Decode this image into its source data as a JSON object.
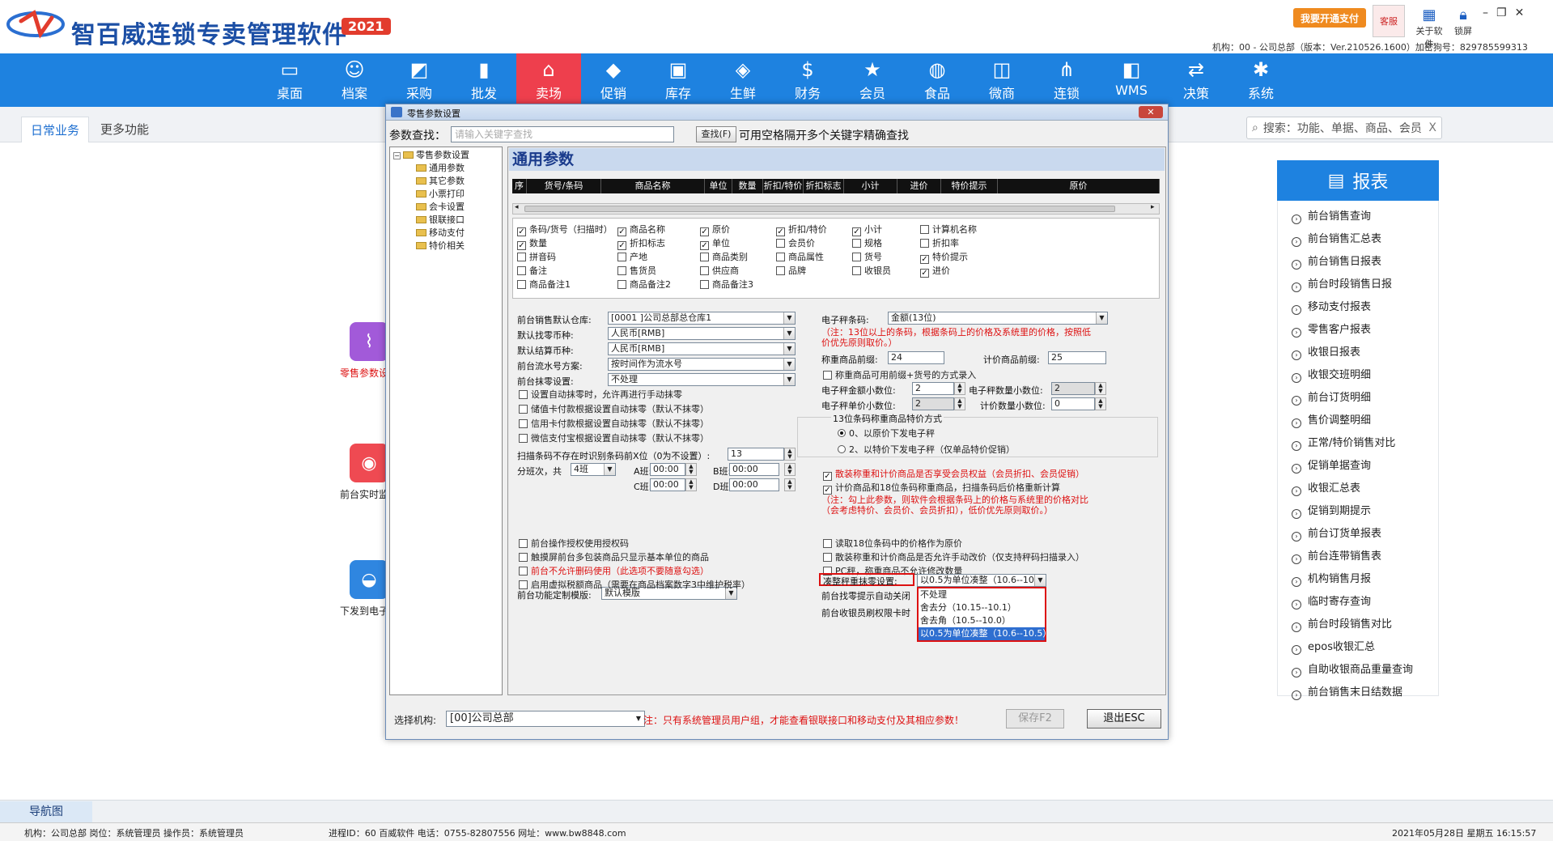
{
  "app": {
    "title": "智百威连锁专卖管理软件",
    "year": "2021",
    "pay_button": "我要开通支付",
    "service_label": "客服",
    "about_label": "关于软件",
    "lock_label": "锁屏",
    "org_info": "机构：00 - 公司总部（版本：Ver.210526.1600）加密狗号：829785599313"
  },
  "menu": [
    {
      "label": "桌面",
      "icon": "monitor-icon",
      "glyph": "▭"
    },
    {
      "label": "档案",
      "icon": "user-icon",
      "glyph": "☺"
    },
    {
      "label": "采购",
      "icon": "chart-icon",
      "glyph": "◩"
    },
    {
      "label": "批发",
      "icon": "bar-chart-icon",
      "glyph": "▮"
    },
    {
      "label": "卖场",
      "icon": "store-icon",
      "glyph": "⌂"
    },
    {
      "label": "促销",
      "icon": "tag-icon",
      "glyph": "◆"
    },
    {
      "label": "库存",
      "icon": "box-icon",
      "glyph": "▣"
    },
    {
      "label": "生鲜",
      "icon": "fish-icon",
      "glyph": "◈"
    },
    {
      "label": "财务",
      "icon": "money-icon",
      "glyph": "$"
    },
    {
      "label": "会员",
      "icon": "star-icon",
      "glyph": "★"
    },
    {
      "label": "食品",
      "icon": "basket-icon",
      "glyph": "◍"
    },
    {
      "label": "微商",
      "icon": "shop-icon",
      "glyph": "◫"
    },
    {
      "label": "连锁",
      "icon": "share-icon",
      "glyph": "⋔"
    },
    {
      "label": "WMS",
      "icon": "cubes-icon",
      "glyph": "◧"
    },
    {
      "label": "决策",
      "icon": "decision-icon",
      "glyph": "⇄"
    },
    {
      "label": "系统",
      "icon": "gear-icon",
      "glyph": "✱"
    }
  ],
  "tabs": {
    "daily": "日常业务",
    "more": "更多功能"
  },
  "search": {
    "placeholder": "搜索：功能、单据、商品、会员",
    "clear": "X"
  },
  "functions": [
    {
      "label": "零售参数设置"
    },
    {
      "label": "前台实时监控"
    },
    {
      "label": "下发到电子秤"
    }
  ],
  "report": {
    "title": "报表",
    "items": [
      "前台销售查询",
      "前台销售汇总表",
      "前台销售日报表",
      "前台时段销售日报",
      "移动支付报表",
      "零售客户报表",
      "收银日报表",
      "收银交班明细",
      "前台订货明细",
      "售价调整明细",
      "正常/特价销售对比",
      "促销单据查询",
      "收银汇总表",
      "促销到期提示",
      "前台订货单报表",
      "前台连带销售表",
      "机构销售月报",
      "临时寄存查询",
      "前台时段销售对比",
      "epos收银汇总",
      "自助收银商品重量查询",
      "前台销售末日结数据"
    ]
  },
  "navtab": "导航图",
  "status": {
    "left": "机构：公司总部  岗位：系统管理员  操作员：系统管理员",
    "mid": "进程ID：60  百威软件 电话：0755-82807556 网址：www.bw8848.com",
    "right": "2021年05月28日 星期五     16:15:57"
  },
  "dialog": {
    "title": "零售参数设置",
    "close": "✕",
    "search_label": "参数查找：",
    "search_placeholder": "请输入关键字查找",
    "search_button": "查找(F)",
    "search_hint": "可用空格隔开多个关键字精确查找",
    "tree": {
      "root": "零售参数设置",
      "children": [
        "通用参数",
        "其它参数",
        "小票打印",
        "会卡设置",
        "银联接口",
        "移动支付",
        "特价相关"
      ]
    },
    "panel_title": "通用参数",
    "grid_columns": [
      "序",
      "货号/条码",
      "商品名称",
      "单位",
      "数量",
      "折扣/特价",
      "折扣标志",
      "小计",
      "进价",
      "特价提示",
      "原价"
    ],
    "column_checks": [
      [
        "条码/货号（扫描时）",
        true
      ],
      [
        "商品名称",
        true
      ],
      [
        "原价",
        true
      ],
      [
        "折扣/特价",
        true
      ],
      [
        "小计",
        true
      ],
      [
        "计算机名称",
        false
      ],
      [
        "数量",
        true
      ],
      [
        "折扣标志",
        true
      ],
      [
        "单位",
        true
      ],
      [
        "会员价",
        false
      ],
      [
        "规格",
        false
      ],
      [
        "折扣率",
        false
      ],
      [
        "拼音码",
        false
      ],
      [
        "产地",
        false
      ],
      [
        "商品类别",
        false
      ],
      [
        "商品属性",
        false
      ],
      [
        "货号",
        false
      ],
      [
        "特价提示",
        true
      ],
      [
        "备注",
        false
      ],
      [
        "售货员",
        false
      ],
      [
        "供应商",
        false
      ],
      [
        "品牌",
        false
      ],
      [
        "收银员",
        false
      ],
      [
        "进价",
        true
      ],
      [
        "商品备注1",
        false
      ],
      [
        "商品备注2",
        false
      ],
      [
        "商品备注3",
        false
      ]
    ],
    "left": {
      "warehouse_label": "前台销售默认仓库:",
      "warehouse_value": "[0001  ]公司总部总仓库1",
      "change_currency_label": "默认找零币种:",
      "change_currency_value": "人民币[RMB]",
      "settle_currency_label": "默认结算币种:",
      "settle_currency_value": "人民币[RMB]",
      "flow_label": "前台流水号方案:",
      "flow_value": "按时间作为流水号",
      "round_label": "前台抹零设置:",
      "round_value": "不处理",
      "checks": [
        "设置自动抹零时，允许再进行手动抹零",
        "储值卡付款根据设置自动抹零（默认不抹零）",
        "信用卡付款根据设置自动抹零（默认不抹零）",
        "微信支付宝根据设置自动抹零（默认不抹零）"
      ],
      "scan_label": "扫描条码不存在时识别条码前X位（0为不设置）:",
      "scan_value": "13",
      "shift_label": "分班次，共",
      "shift_value": "4班",
      "shift_a": "A班:",
      "shift_b": "B班:",
      "shift_c": "C班:",
      "shift_d": "D班:",
      "time_a": "00:00",
      "time_b": "00:00",
      "time_c": "00:00",
      "time_d": "00:00",
      "checks2": [
        "前台操作授权使用授权码",
        "触摸屏前台多包装商品只显示基本单位的商品"
      ],
      "red_check": "前台不允许删码使用（此选项不要随意勾选）",
      "check_tax": "启用虚拟税额商品（需要在商品档案数字3中维护税率）",
      "template_label": "前台功能定制模版:",
      "template_value": "默认模版"
    },
    "right": {
      "scale_label": "电子秤条码:",
      "scale_value": "金额(13位)",
      "scale_note": "（注：13位以上的条码，根据条码上的价格及系统里的价格，按照低价优先原则取价。）",
      "weigh_prefix_label": "称重商品前缀:",
      "weigh_prefix_value": "24",
      "count_prefix_label": "计价商品前缀:",
      "count_prefix_value": "25",
      "weigh_check": "称重商品可用前缀+货号的方式录入",
      "amount_dec_label": "电子秤金额小数位:",
      "amount_dec_value": "2",
      "qty_dec_label": "电子秤数量小数位:",
      "qty_dec_value": "2",
      "price_dec_label": "电子秤单价小数位:",
      "price_dec_value": "2",
      "count_dec_label": "计价数量小数位:",
      "count_dec_value": "0",
      "group_title": "13位条码称重商品特价方式",
      "radio1": "0、以原价下发电子秤",
      "radio2": "2、以特价下发电子秤（仅单品特价促销）",
      "red_check1": "散装称重和计价商品是否享受会员权益（会员折扣、会员促销）",
      "check2": "计价商品和18位条码称重商品，扫描条码后价格重新计算",
      "note2": "（注：勾上此参数，则软件会根据条码上的价格与系统里的价格对比（会考虑特价、会员价、会员折扣），低价优先原则取价。）",
      "check3": "读取18位条码中的价格作为原价",
      "check4": "散装称重和计价商品是否允许手动改价（仅支持秤码扫描录入）",
      "check5": "PC秤，称重商品不允许修改数量",
      "round_label": "凑整秤重抹零设置:",
      "round_value": "以0.5为单位凑整（10.6--10.5）",
      "hint_label": "前台找零提示自动关闭",
      "card_label": "前台收银员刷权限卡时",
      "options": [
        "不处理",
        "舍去分（10.15--10.1）",
        "舍去角（10.5--10.0）",
        "以0.5为单位凑整（10.6--10.5）"
      ]
    },
    "org_label": "选择机构:",
    "org_value": "[00]公司总部",
    "org_note": "注：只有系统管理员用户组，才能查看银联接口和移动支付及其相应参数！",
    "save": "保存F2",
    "exit": "退出ESC"
  }
}
